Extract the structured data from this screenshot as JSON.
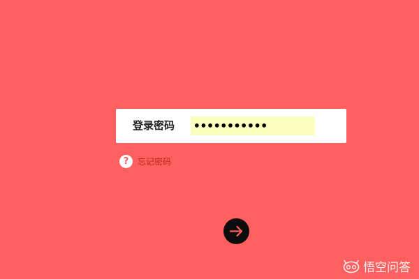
{
  "login": {
    "password_label": "登录密码",
    "password_value": "•••••••••••"
  },
  "forgot": {
    "icon_text": "?",
    "label": "忘记密码"
  },
  "submit": {
    "icon": "arrow-right-icon"
  },
  "watermark": {
    "text": "悟空问答"
  },
  "colors": {
    "background": "#fe5f5f",
    "input_fill": "#fbffbd",
    "forgot_text": "#c0241f",
    "button": "#0c0c0c",
    "arrow": "#fe5f5f"
  }
}
